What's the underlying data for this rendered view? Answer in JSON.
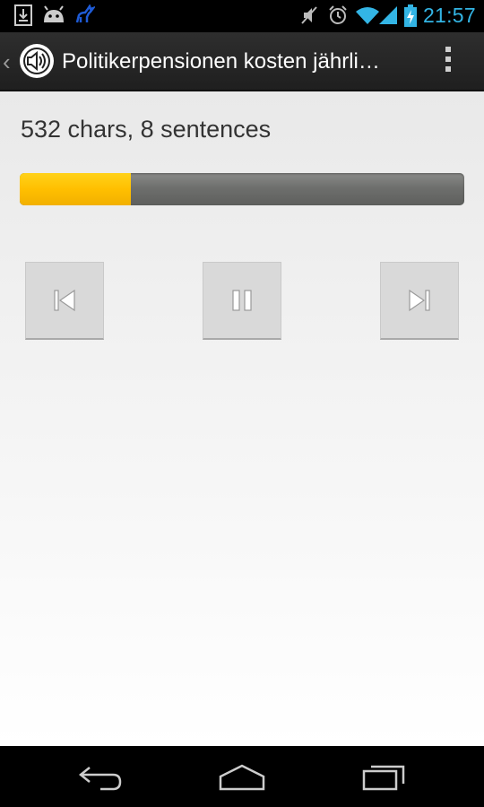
{
  "status_bar": {
    "time": "21:57",
    "icons": [
      "download-icon",
      "android-icon",
      "deer-icon",
      "mute-icon",
      "alarm-icon",
      "wifi-icon",
      "signal-icon",
      "battery-charging-icon"
    ]
  },
  "action_bar": {
    "title": "Politikerpensionen kosten jährli…",
    "icons": [
      "up-caret-icon",
      "app-speaker-icon",
      "overflow-menu-icon"
    ]
  },
  "content": {
    "stats_text": "532 chars, 8 sentences",
    "progress_fraction": 0.25,
    "controls": [
      "skip-previous-icon",
      "pause-icon",
      "skip-next-icon"
    ]
  },
  "nav_bar": {
    "icons": [
      "back-icon",
      "home-icon",
      "recent-apps-icon"
    ]
  },
  "colors": {
    "accent": "#33b5e5",
    "progress_fill": "#ffbf00",
    "progress_track": "#6e6f6d",
    "button_bg": "#d9d9d9",
    "content_bg": "#f0f0f0"
  }
}
